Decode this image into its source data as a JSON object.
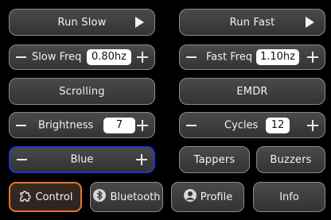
{
  "controls": {
    "run_slow": "Run Slow",
    "run_fast": "Run Fast",
    "slow_freq": {
      "label": "Slow Freq",
      "value": "0.80hz"
    },
    "fast_freq": {
      "label": "Fast Freq",
      "value": "1.10hz"
    },
    "scrolling": "Scrolling",
    "emdr": "EMDR",
    "brightness": {
      "label": "Brightness",
      "value": "7"
    },
    "cycles": {
      "label": "Cycles",
      "value": "12"
    },
    "color": {
      "label": "Blue"
    },
    "tappers": "Tappers",
    "buzzers": "Buzzers"
  },
  "tabs": [
    {
      "label": "Control",
      "icon": "puzzle-icon",
      "active": true
    },
    {
      "label": "Bluetooth",
      "icon": "bluetooth-icon",
      "active": false
    },
    {
      "label": "Profile",
      "icon": "profile-icon",
      "active": false
    },
    {
      "label": "Info",
      "icon": "",
      "active": false
    }
  ],
  "colors": {
    "background": "#000000",
    "button": "#3f3f3f",
    "selected_border": "#2233cc",
    "active_tab_border": "#e8732a"
  }
}
